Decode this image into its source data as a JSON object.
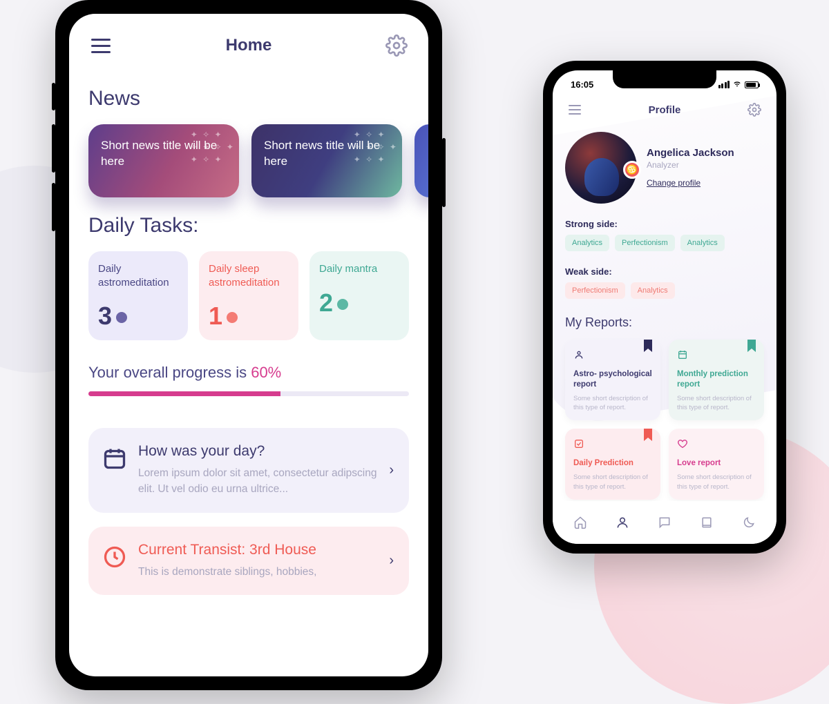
{
  "home": {
    "title": "Home",
    "news_heading": "News",
    "news": [
      {
        "title": "Short news title will be here"
      },
      {
        "title": "Short news title will be here"
      }
    ],
    "tasks_heading": "Daily Tasks:",
    "tasks": [
      {
        "title": "Daily astromeditation",
        "count": "3"
      },
      {
        "title": "Daily sleep astromeditation",
        "count": "1"
      },
      {
        "title": "Daily mantra",
        "count": "2"
      }
    ],
    "progress_prefix": "Your overall progress is ",
    "progress_pct": "60%",
    "progress_value": 60,
    "cards": [
      {
        "title": "How was your day?",
        "desc": "Lorem ipsum dolor sit amet, consectetur adipscing elit. Ut vel odio eu urna ultrice..."
      },
      {
        "title": "Current Transist: 3rd House",
        "desc": "This is demonstrate siblings, hobbies,"
      }
    ]
  },
  "profile": {
    "status_time": "16:05",
    "title": "Profile",
    "name": "Angelica Jackson",
    "role": "Analyzer",
    "change_label": "Change profile",
    "strong_label": "Strong side:",
    "strong_chips": [
      "Analytics",
      "Perfectionism",
      "Analytics"
    ],
    "weak_label": "Weak side:",
    "weak_chips": [
      "Perfectionism",
      "Analytics"
    ],
    "reports_heading": "My Reports:",
    "reports": [
      {
        "title": "Astro- psychological report",
        "desc": "Some short description of this type of report."
      },
      {
        "title": "Monthly prediction report",
        "desc": "Some short description of this type of report."
      },
      {
        "title": "Daily Prediction",
        "desc": "Some short description of this type of report."
      },
      {
        "title": "Love report",
        "desc": "Some short description of this type of report."
      }
    ],
    "tabs": [
      "home",
      "profile",
      "chat",
      "library",
      "night"
    ]
  }
}
